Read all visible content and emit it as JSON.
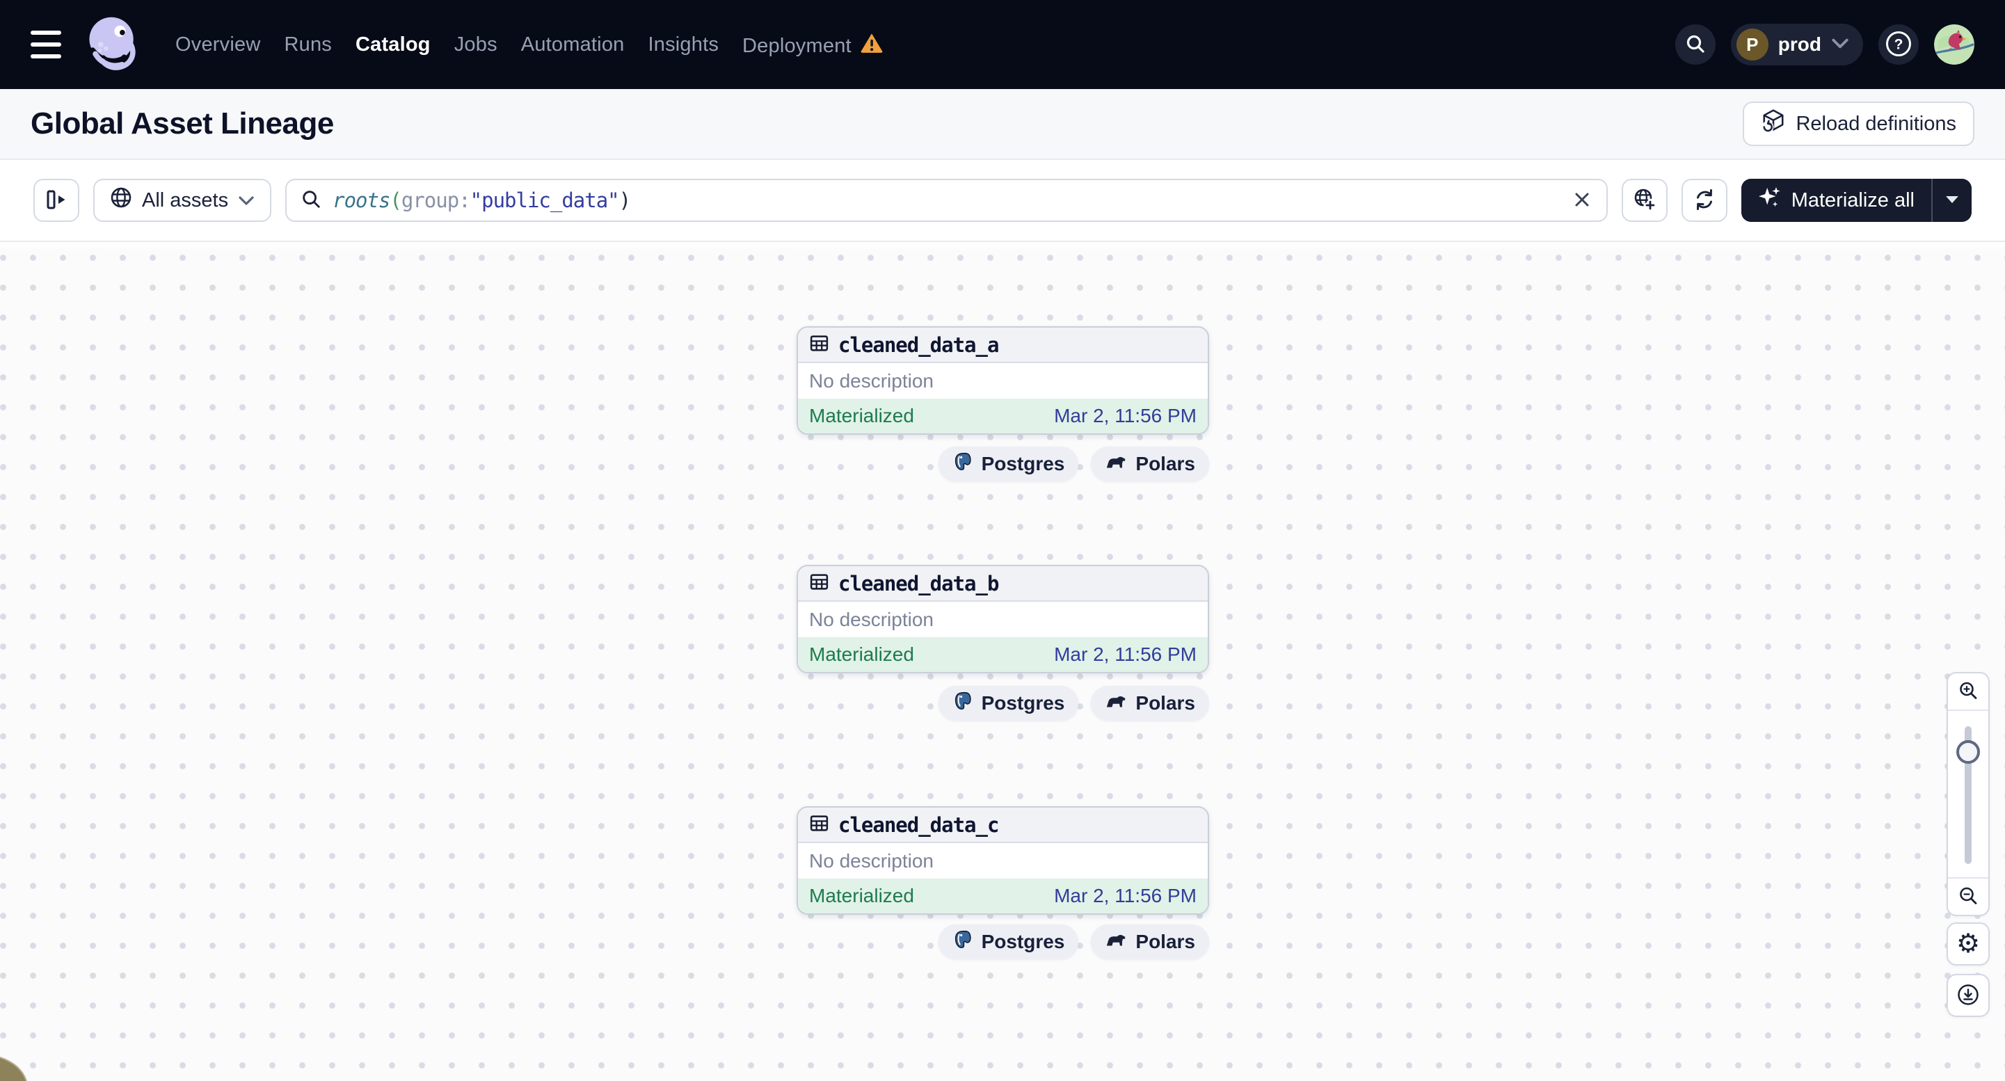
{
  "topnav": {
    "items": [
      {
        "label": "Overview"
      },
      {
        "label": "Runs"
      },
      {
        "label": "Catalog"
      },
      {
        "label": "Jobs"
      },
      {
        "label": "Automation"
      },
      {
        "label": "Insights"
      },
      {
        "label": "Deployment"
      }
    ],
    "active_item": "Catalog",
    "prod": {
      "initial": "P",
      "label": "prod"
    }
  },
  "header": {
    "title": "Global Asset Lineage",
    "reload_label": "Reload definitions"
  },
  "toolbar": {
    "scope_label": "All assets",
    "search_query": {
      "fn": "roots",
      "open_paren": "(",
      "key": "group",
      "colon": ":",
      "value": "\"public_data\"",
      "close_paren": ")"
    },
    "materialize_label": "Materialize all"
  },
  "assets": [
    {
      "name": "cleaned_data_a",
      "description": "No description",
      "status": "Materialized",
      "timestamp": "Mar 2, 11:56 PM",
      "kinds": [
        "Postgres",
        "Polars"
      ]
    },
    {
      "name": "cleaned_data_b",
      "description": "No description",
      "status": "Materialized",
      "timestamp": "Mar 2, 11:56 PM",
      "kinds": [
        "Postgres",
        "Polars"
      ]
    },
    {
      "name": "cleaned_data_c",
      "description": "No description",
      "status": "Materialized",
      "timestamp": "Mar 2, 11:56 PM",
      "kinds": [
        "Postgres",
        "Polars"
      ]
    }
  ],
  "icons": {
    "gear": "⚙",
    "help": "?"
  },
  "colors": {
    "nav_bg": "#070B17",
    "accent_dark": "#161B2D",
    "status_materialized": "#1E7B4D",
    "timestamp": "#303D9B",
    "warning": "#F0A13C",
    "footer_bg": "#E1F2E8"
  }
}
